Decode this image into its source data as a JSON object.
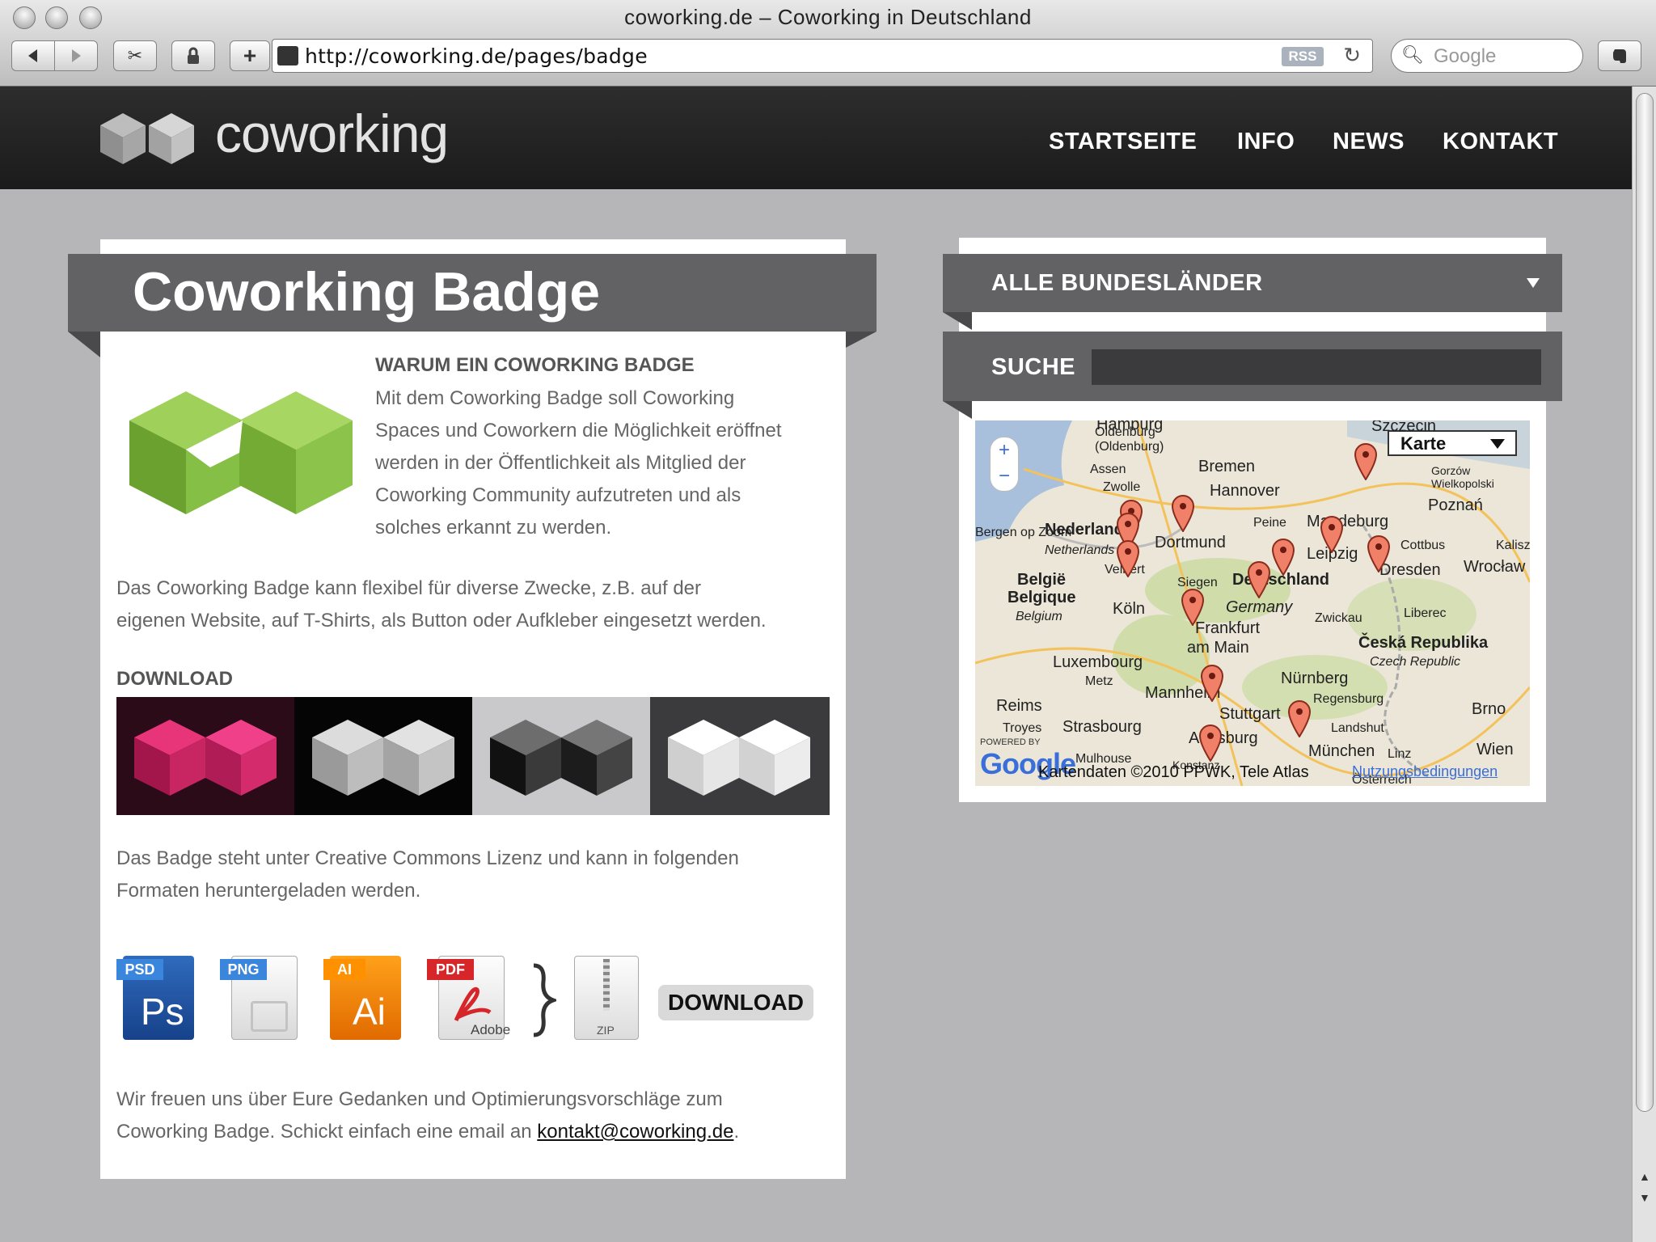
{
  "window": {
    "title": "coworking.de – Coworking in Deutschland"
  },
  "toolbar": {
    "url": "http://coworking.de/pages/badge",
    "rss": "RSS",
    "search_placeholder": "Google"
  },
  "site": {
    "logo": "coworking",
    "nav": [
      "STARTSEITE",
      "INFO",
      "NEWS",
      "KONTAKT"
    ]
  },
  "badge": {
    "title": "Coworking Badge",
    "why_heading": "WARUM EIN COWORKING BADGE",
    "why_lines": [
      "Mit dem Coworking Badge soll Coworking",
      "Spaces und Coworkern die Möglichkeit eröffnet",
      "werden in der Öffentlichkeit als Mitglied der",
      "Coworking Community aufzutreten und als",
      "solches erkannt zu werden."
    ],
    "flex_lines": [
      "Das Coworking Badge kann flexibel für diverse Zwecke, z.B. auf der",
      "eigenen Website, auf T-Shirts, als Button oder Aufkleber eingesetzt werden."
    ],
    "download_heading": "DOWNLOAD",
    "license_lines": [
      "Das Badge steht unter Creative Commons Lizenz und kann in folgenden",
      "Formaten heruntergeladen werden."
    ],
    "formats": [
      "PSD",
      "PNG",
      "AI",
      "PDF"
    ],
    "format_glyphs": [
      "Ps",
      "",
      "Ai",
      "Adobe"
    ],
    "zip_label": "ZIP",
    "download_button": "DOWNLOAD",
    "feedback_line1": "Wir freuen uns über Eure Gedanken und Optimierungsvorschläge zum",
    "feedback_line2_prefix": "Coworking Badge. Schickt einfach eine email an ",
    "email": "kontakt@coworking.de",
    "feedback_suffix": "."
  },
  "sidebar": {
    "region_select": "ALLE BUNDESLÄNDER",
    "search_label": "SUCHE",
    "search_value": ""
  },
  "map": {
    "type_select": "Karte",
    "zoom_in": "+",
    "zoom_out": "−",
    "copyright": "Kartendaten ©2010 PPWK, Tele Atlas",
    "terms": "Nutzungsbedingungen",
    "google": "Google",
    "powered_by": "POWERED BY",
    "labels": [
      "Hamburg",
      "Szczecin",
      "Oldenburg",
      "(Oldenburg)",
      "Assen",
      "Bremen",
      "Gorzów Wielkopolski",
      "Zwolle",
      "Hannover",
      "Poznań",
      "Nederland",
      "Netherlands",
      "Peine",
      "Magdeburg",
      "Dortmund",
      "Bergen op Zoom",
      "Cottbus",
      "Kalisz",
      "Leipzig",
      "Dresden",
      "Wrocław",
      "Velbert",
      "Siegen",
      "Deutschland",
      "Germany",
      "België",
      "Belgique",
      "Belgium",
      "Köln",
      "Zwickau",
      "Liberec",
      "Frankfurt",
      "am Main",
      "Česká Republika",
      "Czech Republic",
      "Luxembourg",
      "Metz",
      "Nürnberg",
      "Mannheim",
      "Regensburg",
      "Reims",
      "Stuttgart",
      "Brno",
      "Landshut",
      "Strasbourg",
      "Augsburg",
      "München",
      "Linz",
      "Wien",
      "Troyes",
      "Mulhouse",
      "Konstanz",
      "Österreich"
    ]
  }
}
